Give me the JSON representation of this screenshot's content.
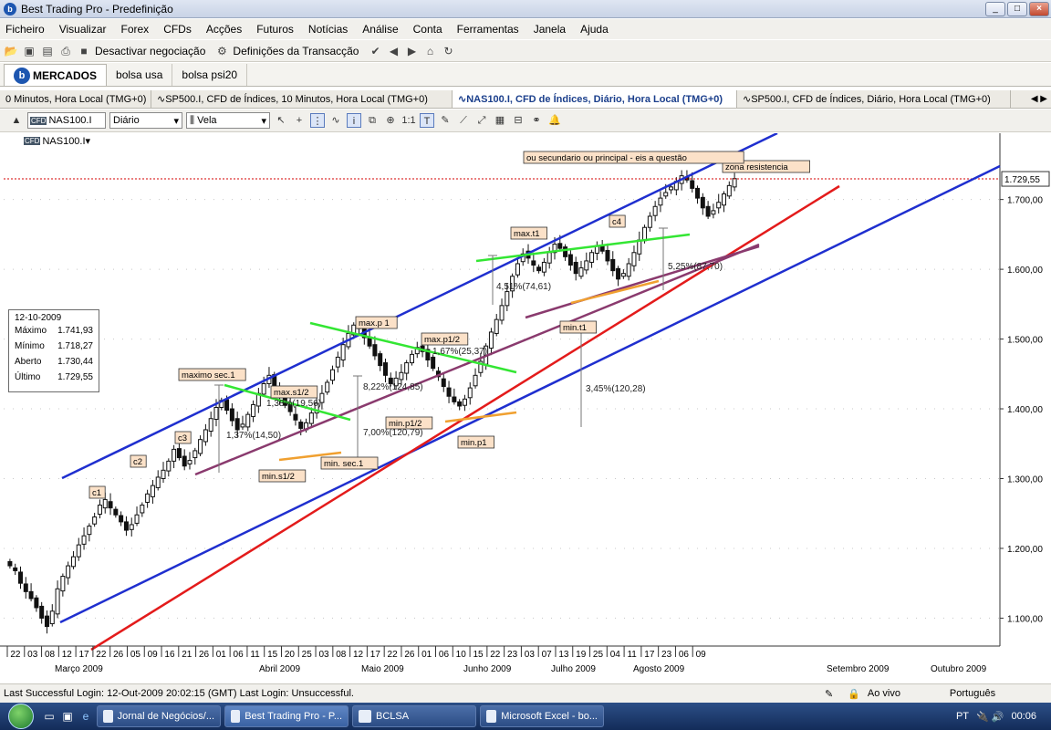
{
  "window": {
    "title": "Best Trading Pro - Predefinição",
    "buttons": [
      "_",
      "□",
      "×"
    ]
  },
  "menu": [
    "Ficheiro",
    "Visualizar",
    "Forex",
    "CFDs",
    "Acções",
    "Futuros",
    "Notícias",
    "Análise",
    "Conta",
    "Ferramentas",
    "Janela",
    "Ajuda"
  ],
  "toolbar": {
    "deactivate": "Desactivar negociação",
    "settings": "Definições da Transacção"
  },
  "workspace_tabs": [
    "MERCADOS",
    "bolsa usa",
    "bolsa psi20"
  ],
  "chart_tabs": [
    {
      "label": "0 Minutos, Hora Local (TMG+0)",
      "active": false
    },
    {
      "label": "SP500.I, CFD de Índices, 10 Minutos, Hora Local (TMG+0)",
      "active": false
    },
    {
      "label": "NAS100.I, CFD de Índices, Diário, Hora Local (TMG+0)",
      "active": true
    },
    {
      "label": "SP500.I, CFD de Índices, Diário, Hora Local (TMG+0)",
      "active": false
    }
  ],
  "chart_toolbar": {
    "symbol": "NAS100.I",
    "period": "Diário",
    "type": "Vela"
  },
  "chart_symbol_label": "NAS100.I",
  "ohlc": {
    "date": "12-10-2009",
    "max_label": "Máximo",
    "max": "1.741,93",
    "min_label": "Mínimo",
    "min": "1.718,27",
    "open_label": "Aberto",
    "open": "1.730,44",
    "last_label": "Último",
    "last": "1.729,55"
  },
  "statusbar": {
    "login": "Last Successful Login: 12-Out-2009 20:02:15 (GMT)   Last Login: Unsuccessful.",
    "live": "Ao vivo",
    "lang": "Português"
  },
  "taskbar": {
    "tasks": [
      "Jornal de Negócios/...",
      "Best Trading Pro - P...",
      "BCLSA",
      "Microsoft Excel - bo..."
    ],
    "lang": "PT",
    "clock": "00:06"
  },
  "chart_data": {
    "type": "candlestick",
    "ylim": [
      1060,
      1795
    ],
    "y_ticks": [
      "1.100,00",
      "1.200,00",
      "1.300,00",
      "1.400,00",
      "1.500,00",
      "1.600,00",
      "1.700,00"
    ],
    "y_tick_values": [
      1100,
      1200,
      1300,
      1400,
      1500,
      1600,
      1700
    ],
    "last_price_label": "1.729,55",
    "last_price": 1729.55,
    "x_day_labels": [
      "22",
      "03",
      "08",
      "12",
      "17",
      "22",
      "26",
      "05",
      "09",
      "16",
      "21",
      "26",
      "01",
      "06",
      "11",
      "15",
      "20",
      "25",
      "03",
      "08",
      "12",
      "17",
      "22",
      "26",
      "01",
      "06",
      "10",
      "15",
      "22",
      "23",
      "03",
      "07",
      "13",
      "19",
      "25",
      "04",
      "11",
      "17",
      "23",
      "06",
      "09"
    ],
    "x_month_labels": [
      "Março 2009",
      "Abril 2009",
      "Maio 2009",
      "Junho 2009",
      "Julho 2009",
      "Agosto 2009",
      "Setembro 2009",
      "Outubro 2009"
    ],
    "annotations": [
      "c1",
      "c2",
      "c3",
      "c4",
      "maximo sec.1",
      "max.s1/2",
      "min.s1/2",
      "min. sec.1",
      "max.p 1",
      "max.p1/2",
      "min.p1/2",
      "min.p1",
      "max.t1",
      "min.t1",
      "zona resistencia",
      "ou secundario ou principal - eis a questão"
    ],
    "measurements": [
      "1,37%(14,50)",
      "1,38%(19,56)",
      "8,22%(124,85)",
      "7,00%(120,79)",
      "1,67%(25,37)",
      "4,51%(74,61)",
      "3,45%(120,28)",
      "5,25%(87,70)"
    ],
    "close": [
      1175,
      1168,
      1150,
      1138,
      1128,
      1115,
      1100,
      1088,
      1110,
      1142,
      1160,
      1175,
      1188,
      1205,
      1218,
      1232,
      1245,
      1262,
      1270,
      1258,
      1248,
      1238,
      1226,
      1234,
      1248,
      1262,
      1278,
      1290,
      1302,
      1312,
      1325,
      1342,
      1330,
      1318,
      1326,
      1340,
      1356,
      1370,
      1386,
      1402,
      1412,
      1398,
      1383,
      1370,
      1378,
      1392,
      1406,
      1422,
      1436,
      1448,
      1430,
      1416,
      1405,
      1396,
      1384,
      1372,
      1380,
      1394,
      1408,
      1422,
      1438,
      1456,
      1474,
      1492,
      1508,
      1520,
      1515,
      1502,
      1490,
      1476,
      1462,
      1448,
      1436,
      1444,
      1452,
      1466,
      1478,
      1488,
      1482,
      1470,
      1458,
      1446,
      1432,
      1418,
      1410,
      1404,
      1414,
      1430,
      1448,
      1468,
      1490,
      1510,
      1528,
      1548,
      1568,
      1590,
      1608,
      1622,
      1616,
      1606,
      1598,
      1610,
      1624,
      1636,
      1630,
      1618,
      1606,
      1594,
      1602,
      1612,
      1624,
      1634,
      1626,
      1612,
      1598,
      1586,
      1594,
      1608,
      1624,
      1642,
      1660,
      1676,
      1690,
      1702,
      1710,
      1718,
      1726,
      1734,
      1728,
      1716,
      1702,
      1688,
      1676,
      1684,
      1696,
      1708,
      1720,
      1730
    ]
  }
}
